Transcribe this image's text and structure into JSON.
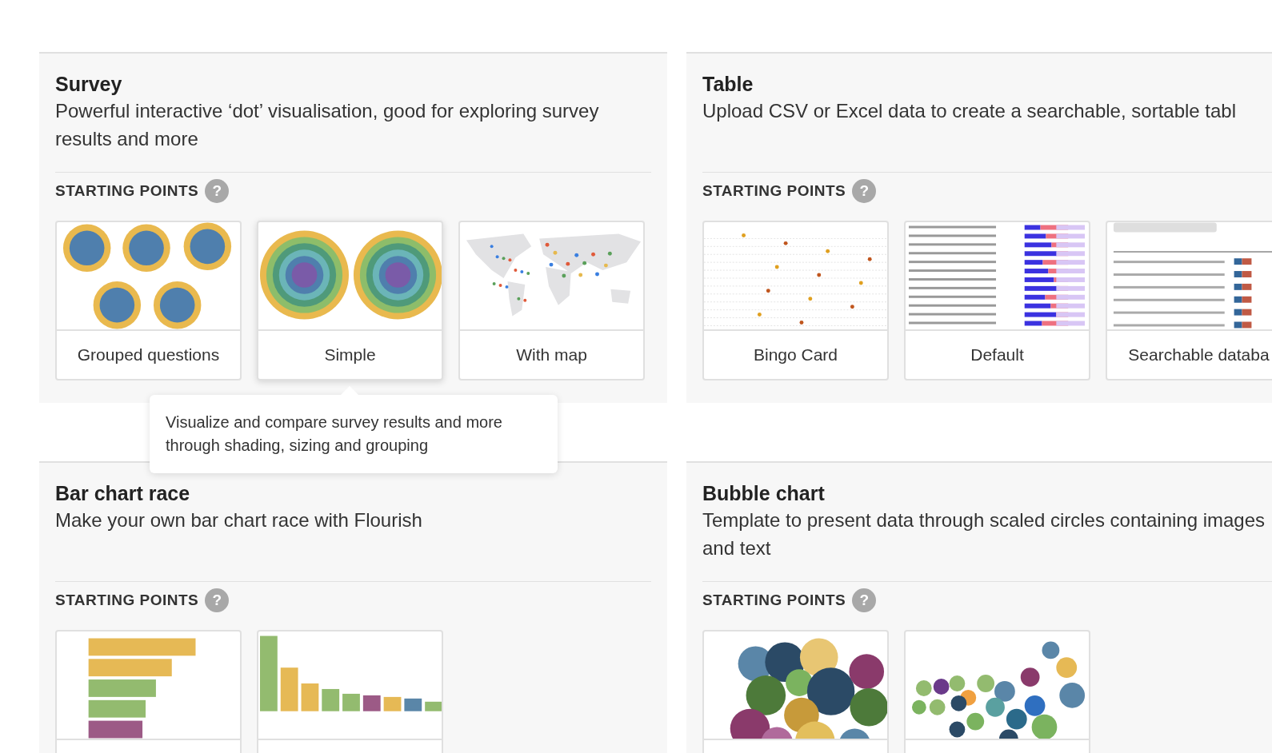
{
  "sections": [
    {
      "title": "Survey",
      "description": "Powerful interactive ‘dot’ visualisation, good for exploring survey results and more",
      "starting_points_label": "STARTING POINTS",
      "help": "?",
      "cards": [
        {
          "label": "Grouped questions",
          "kind": "grouped-dots",
          "highlighted": false
        },
        {
          "label": "Simple",
          "kind": "simple-dots",
          "highlighted": true,
          "tooltip": "Visualize and compare survey results and more through shading, sizing and grouping"
        },
        {
          "label": "With map",
          "kind": "world-map",
          "highlighted": false
        }
      ]
    },
    {
      "title": "Table",
      "description": "Upload CSV or Excel data to create a searchable, sortable tabl",
      "starting_points_label": "STARTING POINTS",
      "help": "?",
      "cards": [
        {
          "label": "Bingo Card",
          "kind": "bingo-table",
          "highlighted": false
        },
        {
          "label": "Default",
          "kind": "bar-table",
          "highlighted": false
        },
        {
          "label": "Searchable databa",
          "kind": "search-table",
          "highlighted": false
        }
      ]
    },
    {
      "title": "Bar chart race",
      "description": "Make your own bar chart race with Flourish",
      "starting_points_label": "STARTING POINTS",
      "help": "?",
      "cards": [
        {
          "kind": "horizontal-bars",
          "highlighted": false
        },
        {
          "kind": "vertical-bars",
          "highlighted": false
        }
      ]
    },
    {
      "title": "Bubble chart",
      "description": "Template to present data through scaled circles containing images and text",
      "starting_points_label": "STARTING POINTS",
      "help": "?",
      "cards": [
        {
          "kind": "big-bubbles",
          "highlighted": false
        },
        {
          "kind": "small-bubbles",
          "highlighted": false
        }
      ]
    }
  ]
}
